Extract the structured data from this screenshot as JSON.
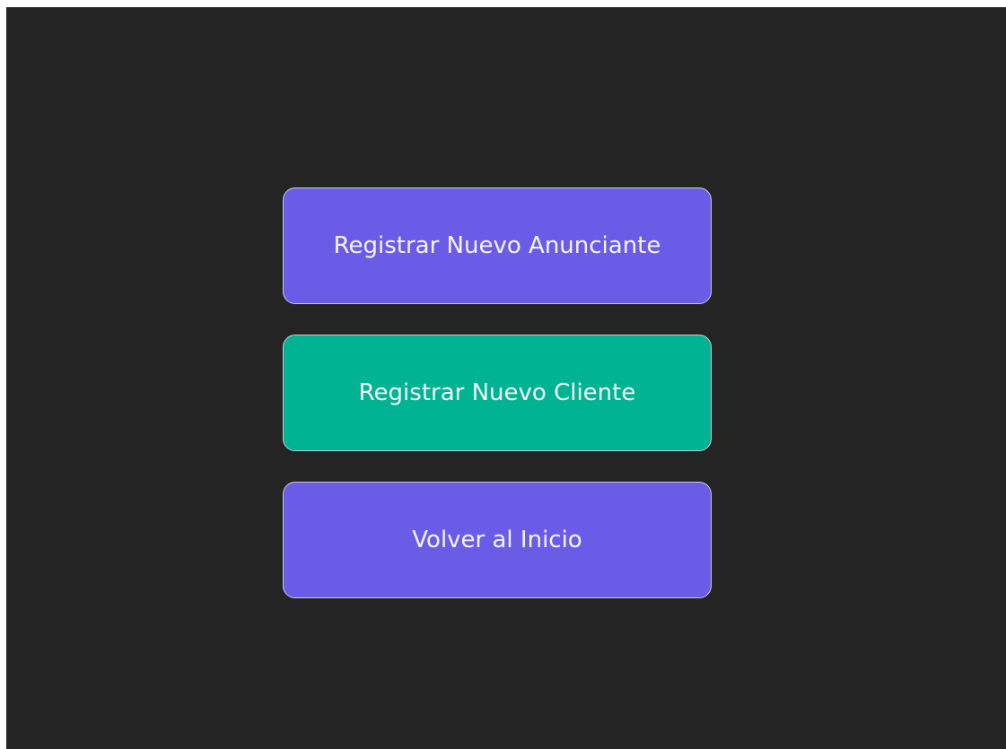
{
  "colors": {
    "background": "#242424",
    "primary_button": "#6b5ce7",
    "secondary_button": "#00b393",
    "button_text": "#f4f4f8",
    "button_border": "#c9c9d6"
  },
  "menu": {
    "buttons": [
      {
        "label": "Registrar Nuevo Anunciante",
        "variant": "primary"
      },
      {
        "label": "Registrar Nuevo Cliente",
        "variant": "secondary"
      },
      {
        "label": "Volver al Inicio",
        "variant": "primary"
      }
    ]
  }
}
